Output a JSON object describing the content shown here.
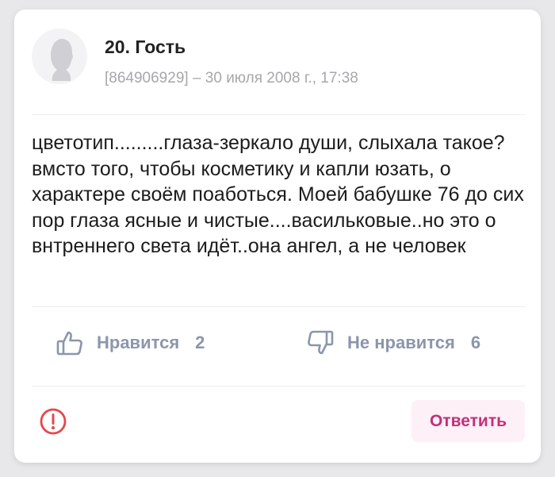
{
  "comment": {
    "author": "20. Гость",
    "meta": "[864906929] – 30 июля 2008 г., 17:38",
    "text": "цветотип.........глаза-зеркало души, слыхала такое? вмсто того, чтобы косметику и капли юзать, о характере своём поаботься. Моей бабушке 76 до сих пор глаза ясные и чистые....васильковые..но это о внтреннего света идёт..она ангел, а не человек"
  },
  "actions": {
    "like_label": "Нравится",
    "like_count": "2",
    "dislike_label": "Не нравится",
    "dislike_count": "6",
    "reply_label": "Ответить"
  },
  "icons": {
    "avatar": "user-silhouette-icon",
    "like": "thumbs-up-icon",
    "dislike": "thumbs-down-icon",
    "report": "exclamation-circle-icon"
  },
  "colors": {
    "accent": "#c2307b",
    "reply_bg": "#fdf0f6",
    "vote": "#8b96ab",
    "meta": "#a7a7ad",
    "report": "#e5484d"
  }
}
